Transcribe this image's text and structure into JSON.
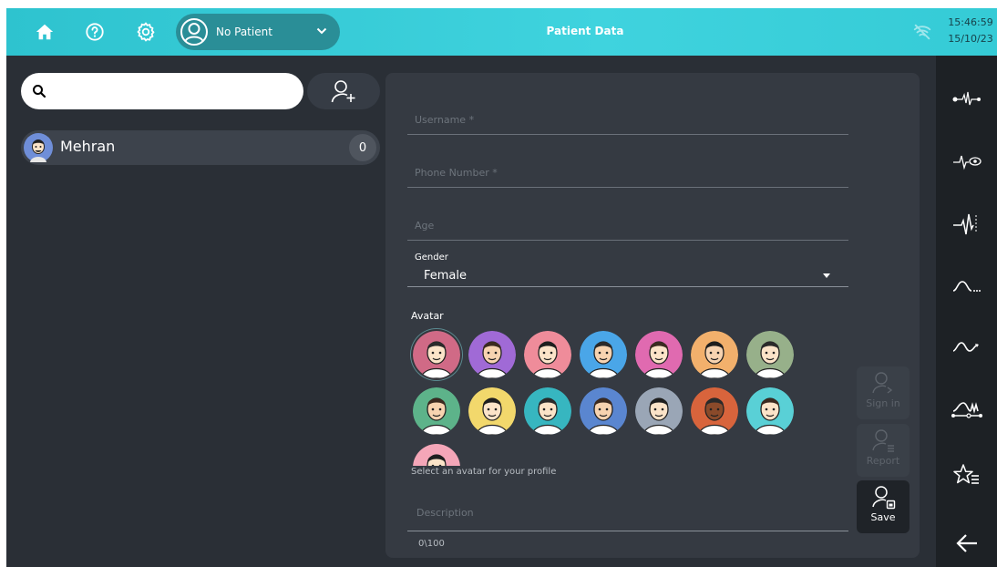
{
  "header": {
    "title": "Patient Data",
    "patient_selector": {
      "value": "No Patient"
    },
    "time": "15:46:59",
    "date": "15/10/23",
    "icons": [
      "home-icon",
      "help-icon",
      "gear-icon",
      "user-circle-icon",
      "chevron-down-icon",
      "wifi-off-icon"
    ]
  },
  "sidebar": {
    "search": {
      "value": "",
      "placeholder": ""
    },
    "patients": [
      {
        "name": "Mehran",
        "count": "0"
      }
    ]
  },
  "form": {
    "username": {
      "placeholder": "Username *"
    },
    "phone": {
      "placeholder": "Phone Number *"
    },
    "age": {
      "placeholder": "Age"
    },
    "gender": {
      "label": "Gender",
      "value": "Female"
    },
    "avatar": {
      "label": "Avatar",
      "hint": "Select an avatar for your profile",
      "colors": [
        "#d06a86",
        "#a06ad6",
        "#ef8c9a",
        "#4aa6e8",
        "#e06ab0",
        "#f2b06c",
        "#97b08a",
        "#5db38a",
        "#f2d86c",
        "#37b6c0",
        "#5a86d0",
        "#9aa6b6",
        "#d8643c",
        "#59d0d6",
        "#f4a6b8"
      ]
    },
    "description": {
      "placeholder": "Description",
      "counter": "0\\100"
    }
  },
  "actions": {
    "sign_in": "Sign in",
    "report": "Report",
    "save": "Save"
  },
  "right_rail": {
    "icons": [
      "ecg-probe-icon",
      "ecg-eye-icon",
      "ecg-peak-icon",
      "wave-dots-icon",
      "wave-arrow-icon",
      "wave-chain-icon",
      "star-list-icon",
      "back-arrow-icon"
    ]
  },
  "colors": {
    "accent": "#35cbd6",
    "background": "#2a2f36",
    "panel": "#353a42",
    "rail": "#1d2125"
  }
}
